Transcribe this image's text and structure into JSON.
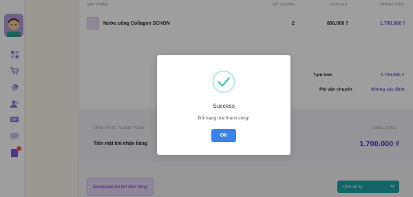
{
  "table": {
    "headers": {
      "product": "SẢN PHẨM",
      "quantity": "SỐ LƯỢNG",
      "unit_price": "ĐƠN GIÁ",
      "total": "THÀNH TIỀN"
    },
    "rows": [
      {
        "product": "Nước uống Collagen SCHON",
        "quantity": "2",
        "unit_price": "850.000 ₫",
        "total": "1.700.000 ₫"
      }
    ]
  },
  "summary": {
    "subtotal_label": "Tạm tính",
    "subtotal_value": "1.700.000 ₫",
    "shipping_label": "Phí vận chuyển",
    "shipping_value": "Không xác định"
  },
  "payment": {
    "method_header": "HÌNH THỨC THANH TOÁN",
    "total_header": "TỔNG CỘNG",
    "method_value": "Tiền mặt khi nhận hàng",
    "total_value": "1.700.000 ₫"
  },
  "actions": {
    "download_label": "Download chi tiết đơn hàng",
    "status_selected": "Chờ xử lý"
  },
  "modal": {
    "title": "Success",
    "message": "Đổi trạng thái thành công!",
    "ok_label": "OK"
  },
  "sidebar": {
    "icons": [
      "dashboard-icon",
      "cart-icon",
      "chart-icon",
      "users-icon",
      "message-icon",
      "chat-icon",
      "document-icon"
    ]
  },
  "colors": {
    "accent_purple": "#6a4fc8",
    "success_teal": "#3cc8b4",
    "ok_blue": "#3b82e6",
    "status_teal": "#1fa2a6"
  }
}
